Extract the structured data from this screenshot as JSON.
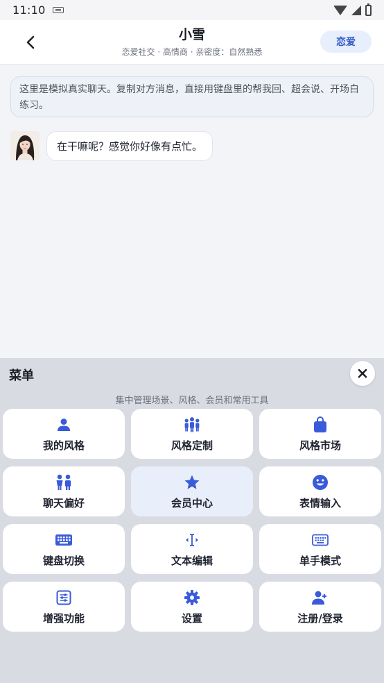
{
  "status_bar": {
    "time": "11:10"
  },
  "header": {
    "back_icon": "chevron-left-icon",
    "title": "小雪",
    "subtitle": "恋爱社交 · 高情商 · 亲密度：自然熟悉",
    "mode_button": "恋爱"
  },
  "notice": {
    "text": "这里是模拟真实聊天。复制对方消息，直接用键盘里的帮我回、超会说、开场白练习。"
  },
  "messages": [
    {
      "sender": "小雪",
      "text": "在干嘛呢？感觉你好像有点忙。"
    }
  ],
  "menu": {
    "title": "菜单",
    "subtitle": "集中管理场景、风格、会员和常用工具",
    "close_icon": "close-icon",
    "accent_color": "#3a5bd9",
    "items": [
      {
        "label": "我的风格",
        "icon": "person-icon"
      },
      {
        "label": "风格定制",
        "icon": "group-icon"
      },
      {
        "label": "风格市场",
        "icon": "shopping-bag-icon"
      },
      {
        "label": "聊天偏好",
        "icon": "people-pair-icon"
      },
      {
        "label": "会员中心",
        "icon": "star-icon",
        "active": true
      },
      {
        "label": "表情输入",
        "icon": "smiley-icon"
      },
      {
        "label": "键盘切换",
        "icon": "keyboard-icon"
      },
      {
        "label": "文本编辑",
        "icon": "text-cursor-icon"
      },
      {
        "label": "单手模式",
        "icon": "keyboard-outline-icon"
      },
      {
        "label": "增强功能",
        "icon": "tune-icon"
      },
      {
        "label": "设置",
        "icon": "gear-icon"
      },
      {
        "label": "注册/登录",
        "icon": "person-add-icon"
      }
    ]
  }
}
